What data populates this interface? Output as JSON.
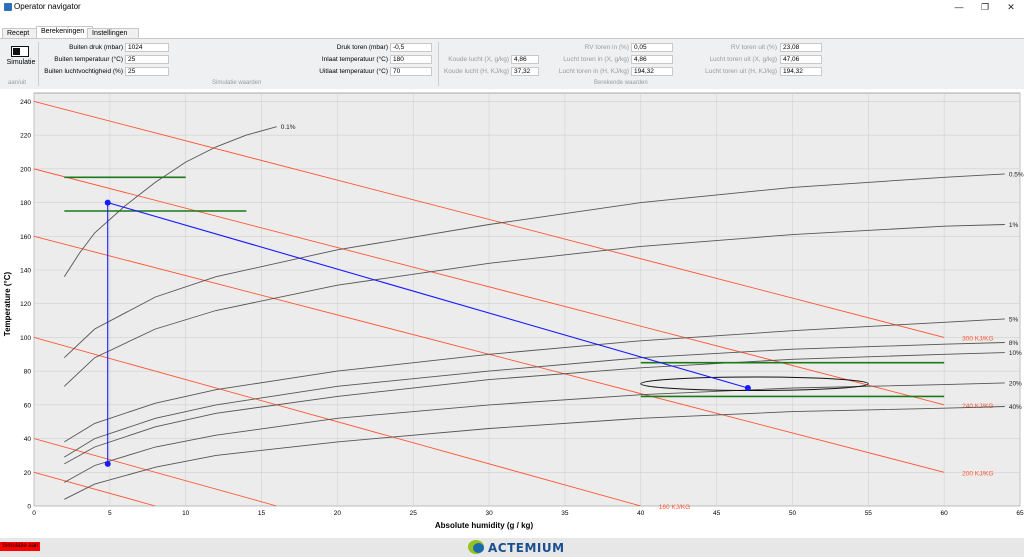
{
  "window": {
    "title": "Operator navigator",
    "minimize": "—",
    "restore": "❐",
    "close": "✕"
  },
  "tabs": [
    {
      "label": "Recept",
      "active": false
    },
    {
      "label": "Berekeningen",
      "active": true
    },
    {
      "label": "Instellingen",
      "active": false
    }
  ],
  "toolbar": {
    "simulatie_label": "Simulatie",
    "aan_uit_caption": "aan/uit",
    "simulatie_waarden_caption": "Simulatie waarden",
    "berekende_waarden_caption": "Berekende waarden"
  },
  "fields": {
    "buiten_druk": {
      "label": "Buiten druk (mbar)",
      "value": "1024"
    },
    "buiten_temp": {
      "label": "Buiten temperatuur (°C)",
      "value": "25"
    },
    "buiten_vocht": {
      "label": "Buiten luchtvochtigheid (%)",
      "value": "25"
    },
    "druk_toren": {
      "label": "Druk toren (mbar)",
      "value": "-0,5"
    },
    "inlaat_temp": {
      "label": "Inlaat temperatuur (°C)",
      "value": "180"
    },
    "uitlaat_temp": {
      "label": "Uitlaat temperatuur (°C)",
      "value": "70"
    },
    "koude_lucht_x": {
      "label": "Koude lucht (X, g/kg)",
      "value": "4,86"
    },
    "koude_lucht_h": {
      "label": "Koude lucht (H, KJ/kg)",
      "value": "37,32"
    },
    "rv_toren_in": {
      "label": "RV toren in (%)",
      "value": "0,05"
    },
    "lucht_toren_in_x": {
      "label": "Lucht toren in (X, g/kg)",
      "value": "4,86"
    },
    "lucht_toren_in_h": {
      "label": "Lucht toren in (H, KJ/kg)",
      "value": "194,32"
    },
    "rv_toren_uit": {
      "label": "RV toren uit (%)",
      "value": "23,08"
    },
    "lucht_toren_uit_x": {
      "label": "Lucht toren uit (X, g/kg)",
      "value": "47,06"
    },
    "lucht_toren_uit_h": {
      "label": "Lucht toren uit (H, KJ/kg)",
      "value": "194,32"
    }
  },
  "status": {
    "simulation_badge": "Simulatie aan",
    "brand": "ACTEMIUM"
  },
  "colors": {
    "rh_curve": "#555555",
    "enthalpy_line": "#ff5533",
    "process_line": "#1a1aff",
    "target_band": "#1a7a1a",
    "grid": "#d0d0d0"
  },
  "chart_data": {
    "type": "line",
    "xlabel": "Absolute humidity (g / kg)",
    "ylabel": "Temperature (°C)",
    "xlim": [
      0,
      65
    ],
    "ylim": [
      0,
      245
    ],
    "xticks": [
      0,
      5,
      10,
      15,
      20,
      25,
      30,
      35,
      40,
      45,
      50,
      55,
      60,
      65
    ],
    "yticks": [
      0,
      20,
      40,
      60,
      80,
      100,
      120,
      140,
      160,
      180,
      200,
      220,
      240
    ],
    "grid": true,
    "rh_curves": [
      {
        "label": "0.1%",
        "points": [
          [
            2,
            136
          ],
          [
            3,
            150
          ],
          [
            4,
            162
          ],
          [
            6,
            178
          ],
          [
            8,
            192
          ],
          [
            10,
            204
          ],
          [
            12,
            213
          ],
          [
            14,
            220
          ],
          [
            16,
            225
          ]
        ]
      },
      {
        "label": "0.5%",
        "points": [
          [
            2,
            88
          ],
          [
            4,
            105
          ],
          [
            8,
            124
          ],
          [
            12,
            136
          ],
          [
            20,
            152
          ],
          [
            30,
            167
          ],
          [
            40,
            180
          ],
          [
            50,
            189
          ],
          [
            60,
            195
          ],
          [
            64,
            197
          ]
        ]
      },
      {
        "label": "1%",
        "points": [
          [
            2,
            71
          ],
          [
            4,
            88
          ],
          [
            8,
            105
          ],
          [
            12,
            116
          ],
          [
            20,
            131
          ],
          [
            30,
            144
          ],
          [
            40,
            154
          ],
          [
            50,
            161
          ],
          [
            60,
            166
          ],
          [
            64,
            167
          ]
        ]
      },
      {
        "label": "5%",
        "points": [
          [
            2,
            38
          ],
          [
            4,
            49
          ],
          [
            8,
            61
          ],
          [
            12,
            69
          ],
          [
            20,
            80
          ],
          [
            30,
            90
          ],
          [
            40,
            98
          ],
          [
            50,
            104
          ],
          [
            60,
            109
          ],
          [
            64,
            111
          ]
        ]
      },
      {
        "label": "8%",
        "points": [
          [
            2,
            29
          ],
          [
            4,
            40
          ],
          [
            8,
            52
          ],
          [
            12,
            60
          ],
          [
            20,
            71
          ],
          [
            30,
            80
          ],
          [
            40,
            88
          ],
          [
            50,
            93
          ],
          [
            60,
            96
          ],
          [
            64,
            97
          ]
        ]
      },
      {
        "label": "10%",
        "points": [
          [
            2,
            25
          ],
          [
            4,
            35
          ],
          [
            8,
            47
          ],
          [
            12,
            55
          ],
          [
            20,
            65
          ],
          [
            30,
            75
          ],
          [
            40,
            82
          ],
          [
            50,
            87
          ],
          [
            60,
            90
          ],
          [
            64,
            91
          ]
        ]
      },
      {
        "label": "20%",
        "points": [
          [
            2,
            14
          ],
          [
            4,
            24
          ],
          [
            8,
            35
          ],
          [
            12,
            42
          ],
          [
            20,
            52
          ],
          [
            30,
            60
          ],
          [
            40,
            66
          ],
          [
            50,
            70
          ],
          [
            60,
            72
          ],
          [
            64,
            73
          ]
        ]
      },
      {
        "label": "40%",
        "points": [
          [
            2,
            4
          ],
          [
            4,
            13
          ],
          [
            8,
            23
          ],
          [
            12,
            30
          ],
          [
            20,
            38
          ],
          [
            30,
            46
          ],
          [
            40,
            52
          ],
          [
            50,
            56
          ],
          [
            60,
            58
          ],
          [
            64,
            59
          ]
        ]
      }
    ],
    "enthalpy_lines": [
      {
        "label": "300 KJ/KG",
        "from": [
          0,
          240
        ],
        "to": [
          60,
          100
        ],
        "show_label": true
      },
      {
        "label": "240 KJ/KG",
        "from": [
          0,
          200
        ],
        "to": [
          60,
          60
        ],
        "show_label": true
      },
      {
        "label": "200 KJ/KG",
        "from": [
          0,
          160
        ],
        "to": [
          60,
          20
        ],
        "show_label": true
      },
      {
        "label": "160 KJ/KG",
        "from": [
          0,
          100
        ],
        "to": [
          40,
          0
        ],
        "show_label": true
      },
      {
        "label": "",
        "from": [
          0,
          40
        ],
        "to": [
          16,
          0
        ],
        "show_label": false
      },
      {
        "label": "",
        "from": [
          0,
          20
        ],
        "to": [
          8,
          0
        ],
        "show_label": false
      }
    ],
    "process": [
      {
        "point": "outside",
        "x": 4.86,
        "y": 25
      },
      {
        "point": "inlet",
        "x": 4.86,
        "y": 180
      },
      {
        "point": "outlet",
        "x": 47.06,
        "y": 70
      }
    ],
    "target_bands": [
      {
        "x": [
          2,
          10
        ],
        "y": 195
      },
      {
        "x": [
          2,
          14
        ],
        "y": 175
      },
      {
        "x": [
          40,
          60
        ],
        "y": 85
      },
      {
        "x": [
          40,
          60
        ],
        "y": 65
      }
    ],
    "target_ellipse": {
      "cx": 47.5,
      "cy": 72.5,
      "rx": 7.5,
      "ry": 4
    }
  }
}
